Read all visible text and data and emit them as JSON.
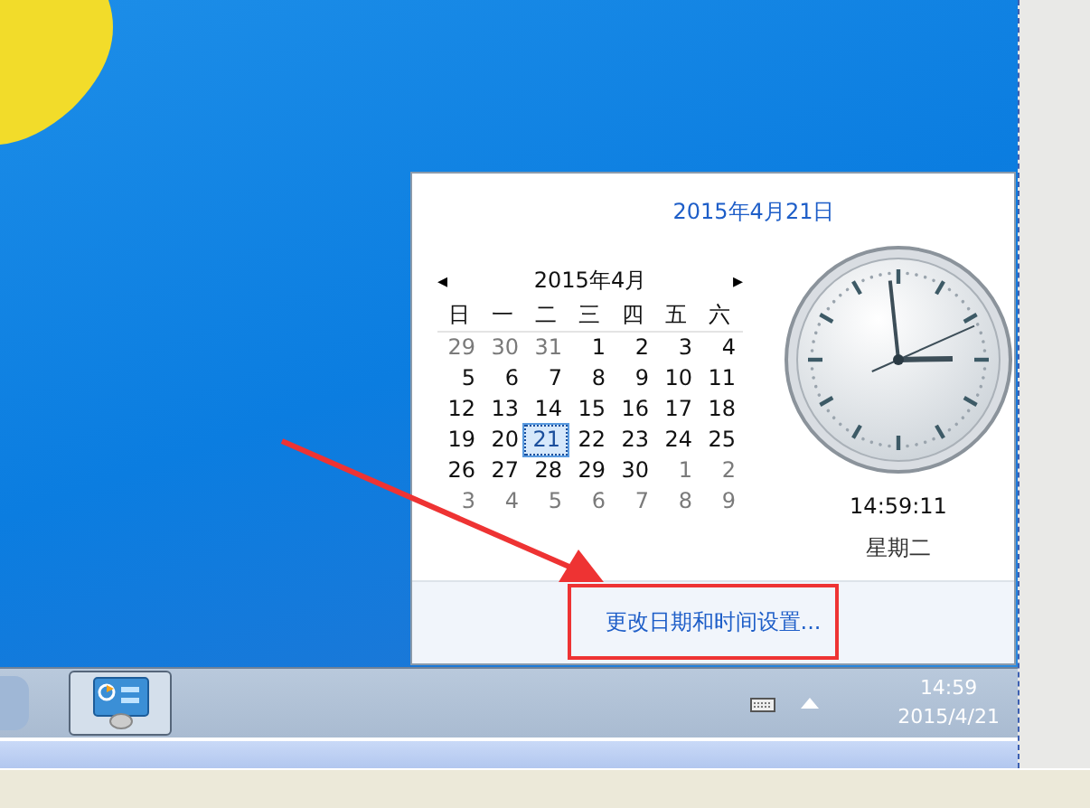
{
  "popup": {
    "date_header": "2015年4月21日",
    "calendar": {
      "prev": "◂",
      "next": "▸",
      "month_title": "2015年4月",
      "weekdays": [
        "日",
        "一",
        "二",
        "三",
        "四",
        "五",
        "六"
      ],
      "days": [
        {
          "label": "29",
          "current": false,
          "selected": false
        },
        {
          "label": "30",
          "current": false,
          "selected": false
        },
        {
          "label": "31",
          "current": false,
          "selected": false
        },
        {
          "label": "1",
          "current": true,
          "selected": false
        },
        {
          "label": "2",
          "current": true,
          "selected": false
        },
        {
          "label": "3",
          "current": true,
          "selected": false
        },
        {
          "label": "4",
          "current": true,
          "selected": false
        },
        {
          "label": "5",
          "current": true,
          "selected": false
        },
        {
          "label": "6",
          "current": true,
          "selected": false
        },
        {
          "label": "7",
          "current": true,
          "selected": false
        },
        {
          "label": "8",
          "current": true,
          "selected": false
        },
        {
          "label": "9",
          "current": true,
          "selected": false
        },
        {
          "label": "10",
          "current": true,
          "selected": false
        },
        {
          "label": "11",
          "current": true,
          "selected": false
        },
        {
          "label": "12",
          "current": true,
          "selected": false
        },
        {
          "label": "13",
          "current": true,
          "selected": false
        },
        {
          "label": "14",
          "current": true,
          "selected": false
        },
        {
          "label": "15",
          "current": true,
          "selected": false
        },
        {
          "label": "16",
          "current": true,
          "selected": false
        },
        {
          "label": "17",
          "current": true,
          "selected": false
        },
        {
          "label": "18",
          "current": true,
          "selected": false
        },
        {
          "label": "19",
          "current": true,
          "selected": false
        },
        {
          "label": "20",
          "current": true,
          "selected": false
        },
        {
          "label": "21",
          "current": true,
          "selected": true
        },
        {
          "label": "22",
          "current": true,
          "selected": false
        },
        {
          "label": "23",
          "current": true,
          "selected": false
        },
        {
          "label": "24",
          "current": true,
          "selected": false
        },
        {
          "label": "25",
          "current": true,
          "selected": false
        },
        {
          "label": "26",
          "current": true,
          "selected": false
        },
        {
          "label": "27",
          "current": true,
          "selected": false
        },
        {
          "label": "28",
          "current": true,
          "selected": false
        },
        {
          "label": "29",
          "current": true,
          "selected": false
        },
        {
          "label": "30",
          "current": true,
          "selected": false
        },
        {
          "label": "1",
          "current": false,
          "selected": false
        },
        {
          "label": "2",
          "current": false,
          "selected": false
        },
        {
          "label": "3",
          "current": false,
          "selected": false
        },
        {
          "label": "4",
          "current": false,
          "selected": false
        },
        {
          "label": "5",
          "current": false,
          "selected": false
        },
        {
          "label": "6",
          "current": false,
          "selected": false
        },
        {
          "label": "7",
          "current": false,
          "selected": false
        },
        {
          "label": "8",
          "current": false,
          "selected": false
        },
        {
          "label": "9",
          "current": false,
          "selected": false
        }
      ]
    },
    "time": "14:59:11",
    "weekday": "星期二",
    "settings_link": "更改日期和时间设置..."
  },
  "taskbar": {
    "clock_time": "14:59",
    "clock_date": "2015/4/21"
  }
}
